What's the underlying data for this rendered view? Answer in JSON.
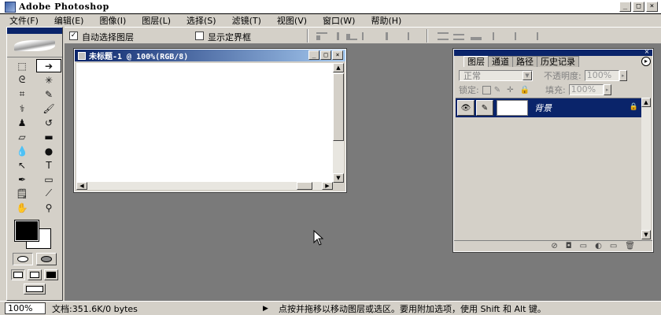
{
  "window": {
    "title": "Adobe Photoshop",
    "controls": {
      "minimize": "_",
      "maximize": "□",
      "close": "×"
    }
  },
  "menu": [
    "文件(F)",
    "编辑(E)",
    "图像(I)",
    "图层(L)",
    "选择(S)",
    "滤镜(T)",
    "视图(V)",
    "窗口(W)",
    "帮助(H)"
  ],
  "options": {
    "auto_select_layer": "自动选择图层",
    "auto_select_checked": "✓",
    "show_bounding_box": "显示定界框"
  },
  "tools": {
    "foreground_color": "#000000",
    "background_color": "#ffffff",
    "list": [
      {
        "name": "marquee-tool-icon",
        "glyph": "⬚"
      },
      {
        "name": "move-tool-icon",
        "glyph": "➔"
      },
      {
        "name": "lasso-tool-icon",
        "glyph": "ᘓ"
      },
      {
        "name": "magic-wand-tool-icon",
        "glyph": "✳"
      },
      {
        "name": "crop-tool-icon",
        "glyph": "⌗"
      },
      {
        "name": "slice-tool-icon",
        "glyph": "✎"
      },
      {
        "name": "healing-brush-tool-icon",
        "glyph": "⚕"
      },
      {
        "name": "brush-tool-icon",
        "glyph": "🖌"
      },
      {
        "name": "clone-stamp-tool-icon",
        "glyph": "♟"
      },
      {
        "name": "history-brush-tool-icon",
        "glyph": "↺"
      },
      {
        "name": "eraser-tool-icon",
        "glyph": "▱"
      },
      {
        "name": "gradient-tool-icon",
        "glyph": "▬"
      },
      {
        "name": "blur-tool-icon",
        "glyph": "💧"
      },
      {
        "name": "dodge-tool-icon",
        "glyph": "●"
      },
      {
        "name": "path-selection-tool-icon",
        "glyph": "↖"
      },
      {
        "name": "type-tool-icon",
        "glyph": "T"
      },
      {
        "name": "pen-tool-icon",
        "glyph": "✒"
      },
      {
        "name": "shape-tool-icon",
        "glyph": "▭"
      },
      {
        "name": "notes-tool-icon",
        "glyph": "🗒"
      },
      {
        "name": "eyedropper-tool-icon",
        "glyph": "⟋"
      },
      {
        "name": "hand-tool-icon",
        "glyph": "✋"
      },
      {
        "name": "zoom-tool-icon",
        "glyph": "⚲"
      }
    ]
  },
  "document": {
    "title": "未标题-1 @ 100%(RGB/8)",
    "controls": {
      "minimize": "_",
      "maximize": "□",
      "close": "×"
    },
    "scroll_up": "▲",
    "scroll_down": "▼",
    "scroll_left": "◀",
    "scroll_right": "▶"
  },
  "layers_panel": {
    "tabs": [
      "图层",
      "通道",
      "路径",
      "历史记录"
    ],
    "close": "×",
    "menu": "▸",
    "blend_mode": "正常",
    "blend_dropdown": "▼",
    "opacity_label": "不透明度:",
    "opacity_value": "100%",
    "lock_label": "锁定:",
    "fill_label": "填充:",
    "fill_value": "100%",
    "stepper": "▸",
    "move_glyph": "✛",
    "lock_glyph": "🔒",
    "layer": {
      "name": "背景",
      "eye": "👁",
      "brush": "✎",
      "lock": "🔒"
    },
    "scroll_up": "▲",
    "scroll_down": "▼",
    "footer": [
      "⊘",
      "◘",
      "▭",
      "◐",
      "▭",
      "🗑"
    ]
  },
  "status": {
    "zoom": "100%",
    "doc": "文档:351.6K/0 bytes",
    "arrow": "▶",
    "hint": "点按并拖移以移动图层或选区。要用附加选项，使用 Shift 和 Alt 键。"
  }
}
